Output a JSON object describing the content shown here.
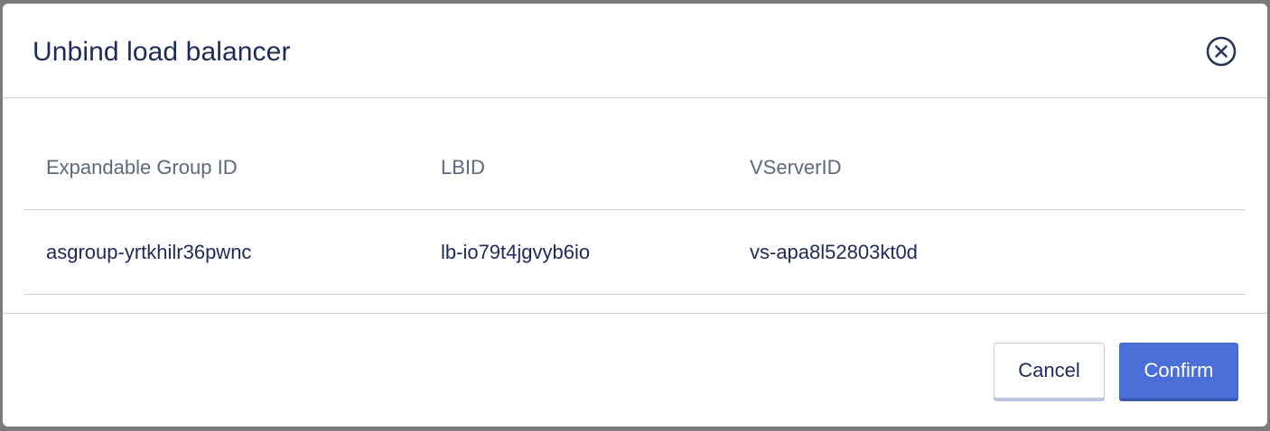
{
  "dialog": {
    "title": "Unbind load balancer",
    "close_icon": "close-circle-icon"
  },
  "table": {
    "columns": [
      "Expandable Group ID",
      "LBID",
      "VServerID"
    ],
    "rows": [
      [
        "asgroup-yrtkhilr36pwnc",
        "lb-io79t4jgvyb6io",
        "vs-apa8l52803kt0d"
      ]
    ]
  },
  "footer": {
    "cancel_label": "Cancel",
    "confirm_label": "Confirm"
  },
  "colors": {
    "title": "#1f2a5c",
    "primary": "#4a6fd9",
    "divider": "#c9cfdb",
    "muted_text": "#5d677d"
  }
}
